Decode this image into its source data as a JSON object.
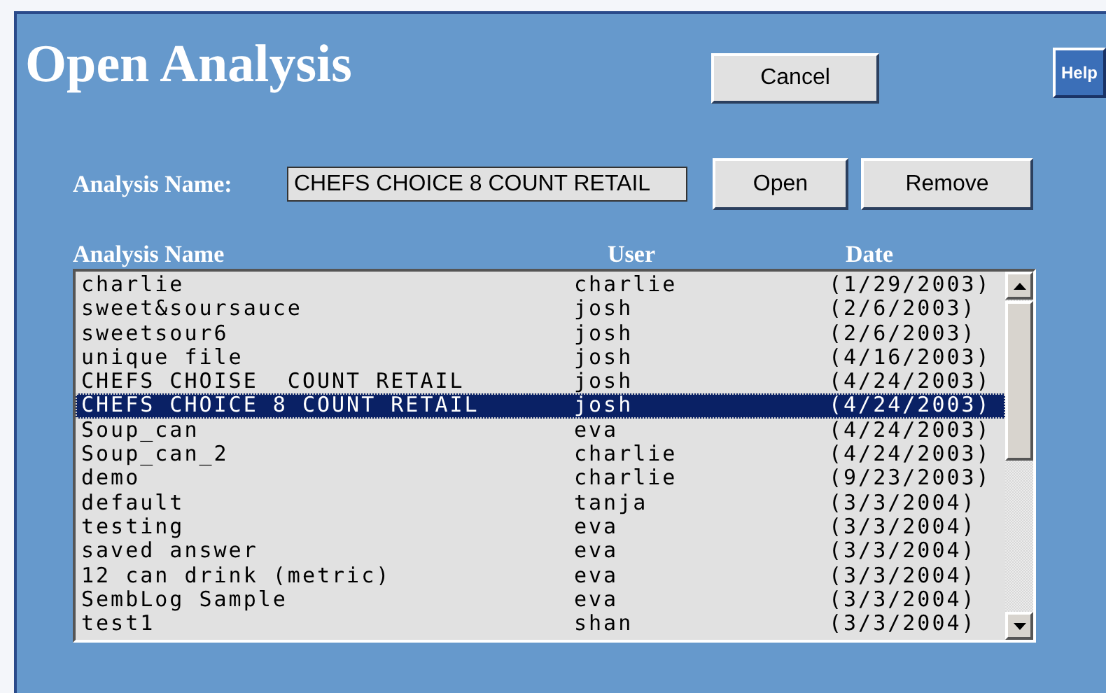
{
  "title": "Open Analysis",
  "buttons": {
    "cancel": "Cancel",
    "help": "Help",
    "open": "Open",
    "remove": "Remove"
  },
  "name_field": {
    "label": "Analysis Name:",
    "value": "CHEFS CHOICE 8 COUNT RETAIL"
  },
  "list": {
    "columns": [
      "Analysis Name",
      "User",
      "Date"
    ],
    "rows": [
      {
        "name": "charlie",
        "user": "charlie",
        "date": "(1/29/2003)",
        "selected": false
      },
      {
        "name": "sweet&soursauce",
        "user": "josh",
        "date": "(2/6/2003)",
        "selected": false
      },
      {
        "name": "sweetsour6",
        "user": "josh",
        "date": "(2/6/2003)",
        "selected": false
      },
      {
        "name": "unique file",
        "user": "josh",
        "date": "(4/16/2003)",
        "selected": false
      },
      {
        "name": "CHEFS CHOISE  COUNT RETAIL",
        "user": "josh",
        "date": "(4/24/2003)",
        "selected": false
      },
      {
        "name": "CHEFS CHOICE 8 COUNT RETAIL",
        "user": "josh",
        "date": "(4/24/2003)",
        "selected": true
      },
      {
        "name": "Soup_can",
        "user": "eva",
        "date": "(4/24/2003)",
        "selected": false
      },
      {
        "name": "Soup_can_2",
        "user": "charlie",
        "date": "(4/24/2003)",
        "selected": false
      },
      {
        "name": "demo",
        "user": "charlie",
        "date": "(9/23/2003)",
        "selected": false
      },
      {
        "name": "default",
        "user": "tanja",
        "date": "(3/3/2004)",
        "selected": false
      },
      {
        "name": "testing",
        "user": "eva",
        "date": "(3/3/2004)",
        "selected": false
      },
      {
        "name": "saved answer",
        "user": "eva",
        "date": "(3/3/2004)",
        "selected": false
      },
      {
        "name": "12 can drink (metric)",
        "user": "eva",
        "date": "(3/3/2004)",
        "selected": false
      },
      {
        "name": "SembLog Sample",
        "user": "eva",
        "date": "(3/3/2004)",
        "selected": false
      },
      {
        "name": "test1",
        "user": "shan",
        "date": "(3/3/2004)",
        "selected": false
      }
    ]
  }
}
